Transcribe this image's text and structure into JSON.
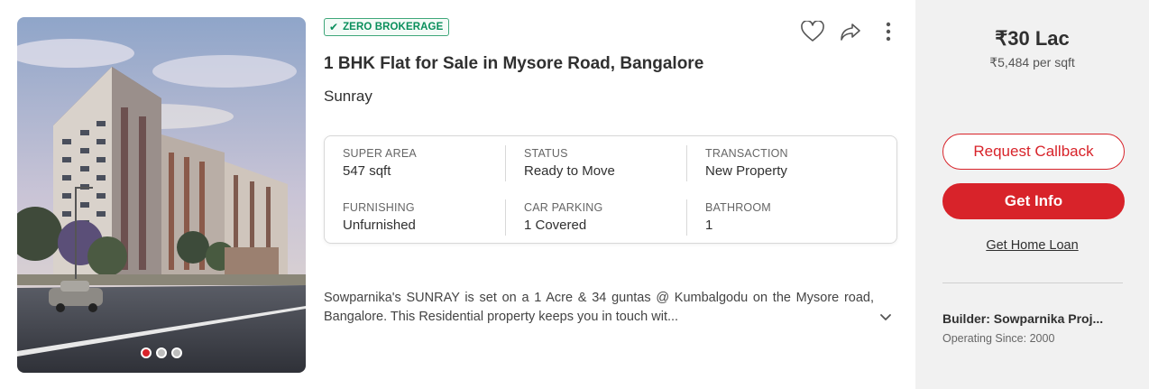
{
  "listing": {
    "badge": "ZERO BROKERAGE",
    "title": "1 BHK Flat for Sale in Mysore Road, Bangalore",
    "society": "Sunray",
    "description": "Sowparnika's SUNRAY is set on a 1 Acre & 34 guntas @ Kumbalgodu on the Mysore road, Bangalore. This Residential property keeps you in touch wit...",
    "photo": {
      "total_slides": 3,
      "active_slide": 1
    }
  },
  "summary": [
    {
      "label": "SUPER AREA",
      "value": "547 sqft"
    },
    {
      "label": "STATUS",
      "value": "Ready to Move"
    },
    {
      "label": "TRANSACTION",
      "value": "New Property"
    },
    {
      "label": "FURNISHING",
      "value": "Unfurnished"
    },
    {
      "label": "CAR PARKING",
      "value": "1 Covered"
    },
    {
      "label": "BATHROOM",
      "value": "1"
    }
  ],
  "pricing": {
    "price": "₹30 Lac",
    "per_sqft": "₹5,484 per sqft"
  },
  "actions": {
    "request_callback": "Request Callback",
    "get_info": "Get Info",
    "home_loan": "Get Home Loan"
  },
  "builder": {
    "name": "Builder: Sowparnika Proj...",
    "operating_since": "Operating Since: 2000"
  },
  "icons": [
    "check-icon",
    "heart-icon",
    "share-icon",
    "more-vertical-icon",
    "chevron-down-icon"
  ],
  "colors": {
    "brand_red": "#d8232a",
    "badge_green": "#0a8f5c",
    "side_bg": "#f1f1f1"
  }
}
